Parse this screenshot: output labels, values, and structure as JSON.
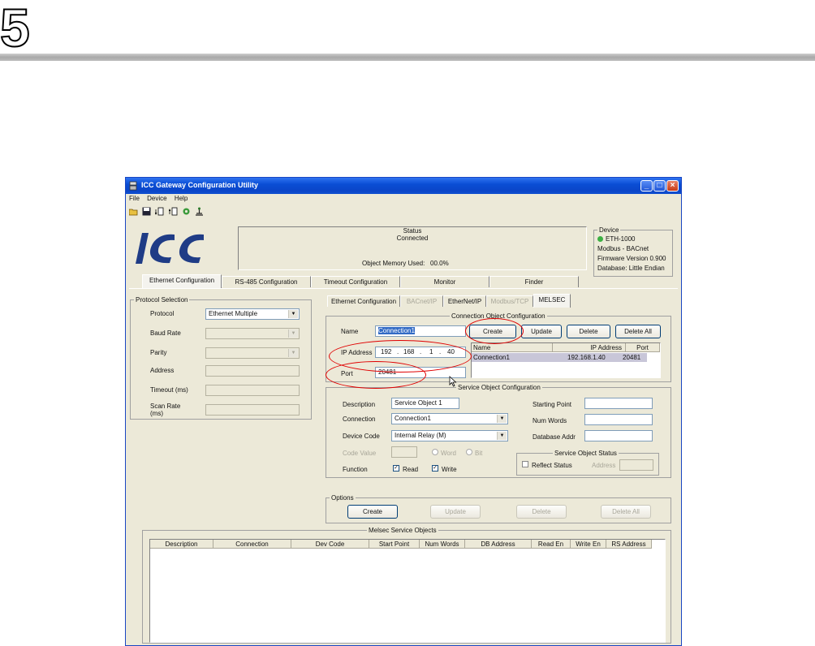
{
  "chapter_number": "5",
  "window": {
    "title": "ICC Gateway Configuration Utility"
  },
  "menu": [
    "File",
    "Device",
    "Help"
  ],
  "status": {
    "heading": "Status",
    "state": "Connected",
    "memory_label": "Object Memory Used:",
    "memory_value": "00.0%"
  },
  "device": {
    "heading": "Device",
    "name": "ETH-1000",
    "protocols": "Modbus - BACnet",
    "firmware": "Firmware Version 0.900",
    "database": "Database: Little Endian",
    "status_color": "#3cb043"
  },
  "logo_text": "ICC",
  "main_tabs": [
    "Ethernet Configuration",
    "RS-485 Configuration",
    "Timeout Configuration",
    "Monitor",
    "Finder"
  ],
  "protocol_selection": {
    "title": "Protocol Selection",
    "protocol_label": "Protocol",
    "protocol_value": "Ethernet Multiple",
    "baud_label": "Baud Rate",
    "parity_label": "Parity",
    "address_label": "Address",
    "timeout_label": "Timeout (ms)",
    "scan_label": "Scan Rate (ms)"
  },
  "sub_tabs": [
    "Ethernet Configuration",
    "BACnet/IP",
    "EtherNet/IP",
    "Modbus/TCP",
    "MELSEC"
  ],
  "connection": {
    "title": "Connection Object Configuration",
    "name_label": "Name",
    "name_value": "Connection1",
    "ip_label": "IP Address",
    "ip": [
      "192",
      "168",
      "1",
      "40"
    ],
    "port_label": "Port",
    "port_value": "20481",
    "buttons": {
      "create": "Create",
      "update": "Update",
      "delete": "Delete",
      "delete_all": "Delete All"
    },
    "list_headers": [
      "Name",
      "IP Address",
      "Port"
    ],
    "list_rows": [
      {
        "name": "Connection1",
        "ip": "192.168.1.40",
        "port": "20481"
      }
    ]
  },
  "service": {
    "title": "Service Object Configuration",
    "description_label": "Description",
    "description_value": "Service Object 1",
    "connection_label": "Connection",
    "connection_value": "Connection1",
    "device_code_label": "Device Code",
    "device_code_value": "Internal Relay (M)",
    "code_value_label": "Code Value",
    "word_label": "Word",
    "bit_label": "Bit",
    "function_label": "Function",
    "read_label": "Read",
    "write_label": "Write",
    "starting_point_label": "Starting Point",
    "num_words_label": "Num Words",
    "db_addr_label": "Database Addr",
    "status_title": "Service Object Status",
    "reflect_label": "Reflect Status",
    "address_label": "Address"
  },
  "options": {
    "title": "Options",
    "create": "Create",
    "update": "Update",
    "delete": "Delete",
    "delete_all": "Delete All"
  },
  "melsec_list": {
    "title": "Melsec Service Objects",
    "headers": [
      "Description",
      "Connection",
      "Dev Code",
      "Start Point",
      "Num Words",
      "DB Address",
      "Read En",
      "Write En",
      "RS Address"
    ]
  },
  "colors": {
    "highlight": "#e00000",
    "selection": "#316ac5",
    "row_selected": "#c8c6d8"
  }
}
